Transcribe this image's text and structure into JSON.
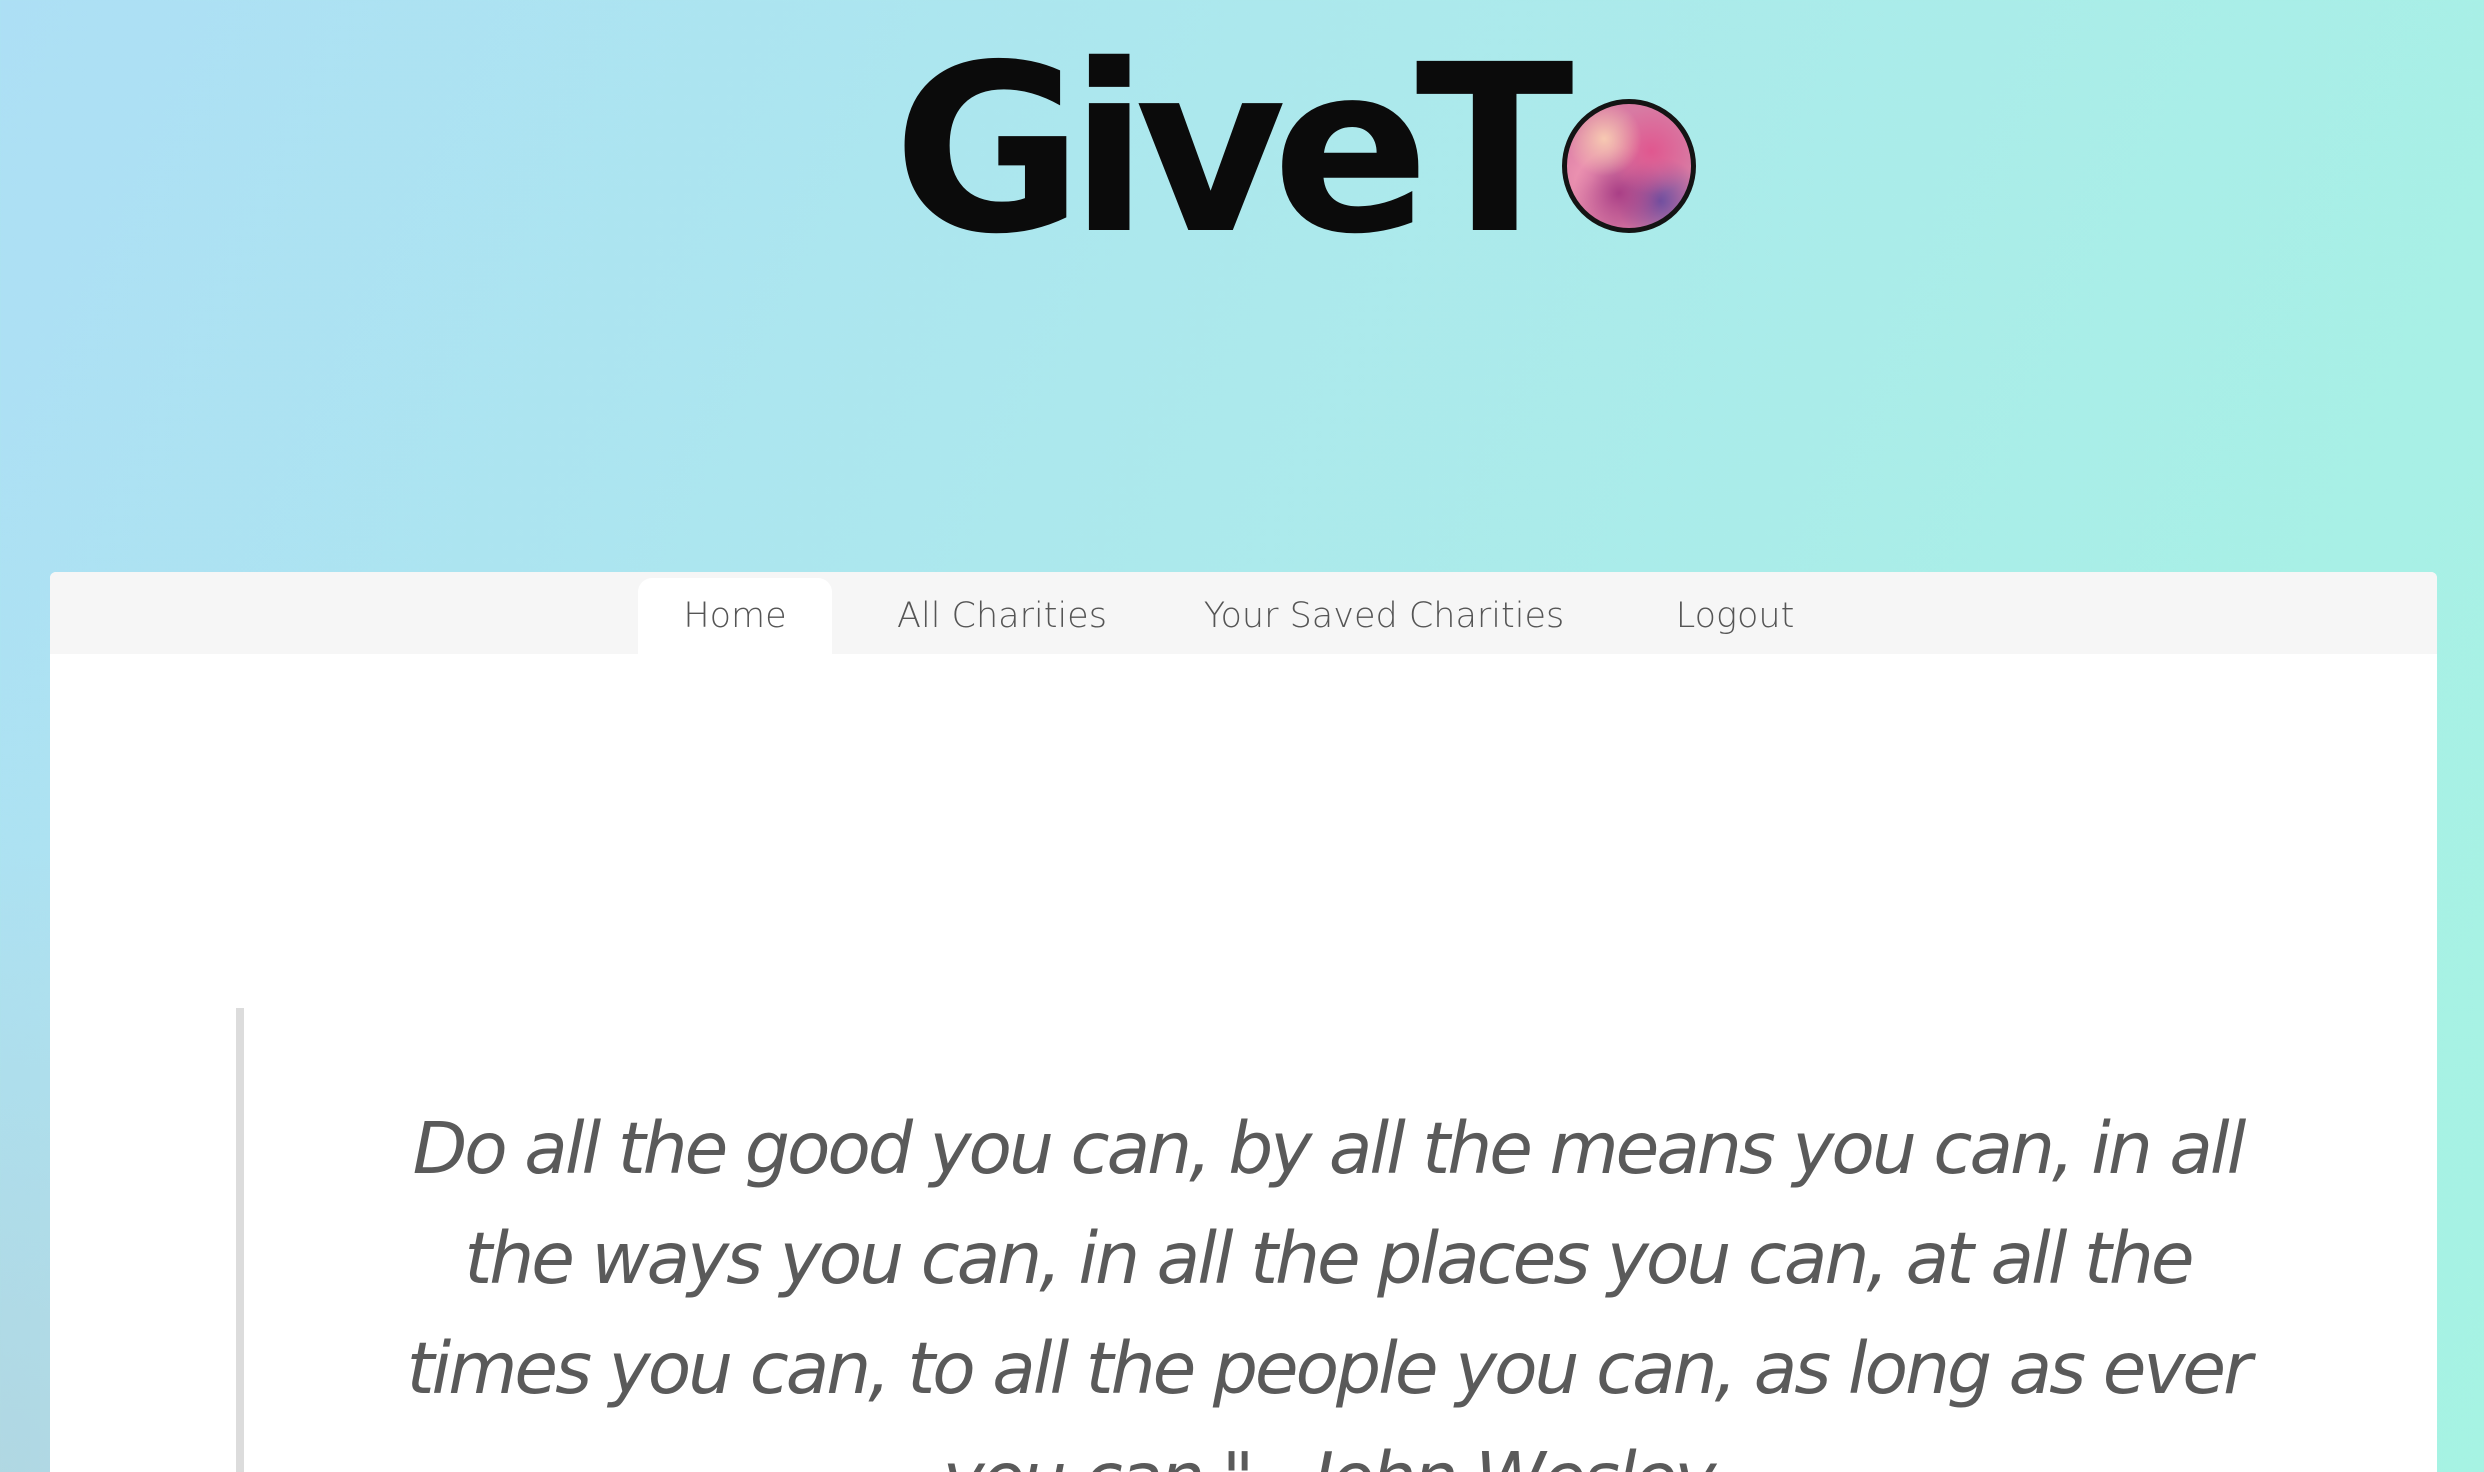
{
  "brand": {
    "logo_text": "GiveT",
    "logo_orb_icon": "watercolor-orb-icon",
    "logo_color": "#0b0b0b",
    "orb_colors": [
      "#f7c9b2",
      "#e0578f",
      "#a93f86",
      "#6d4fa0"
    ]
  },
  "nav": {
    "tabs": [
      {
        "label": "Home",
        "active": true
      },
      {
        "label": "All Charities",
        "active": false
      },
      {
        "label": "Your Saved Charities",
        "active": false
      },
      {
        "label": "Logout",
        "active": false
      }
    ]
  },
  "main": {
    "quote": "Do all the good you can, by all the means you can, in all the ways you can, in all the places you can, at all the times you can, to all the people you can, as long as ever you can.\" - John Wesley"
  },
  "colors": {
    "background_start": "#addff5",
    "background_end": "#a6f3e3",
    "tabbar_bg": "#f6f6f6",
    "text": "#555555",
    "quote_border": "#dcdcdc"
  }
}
